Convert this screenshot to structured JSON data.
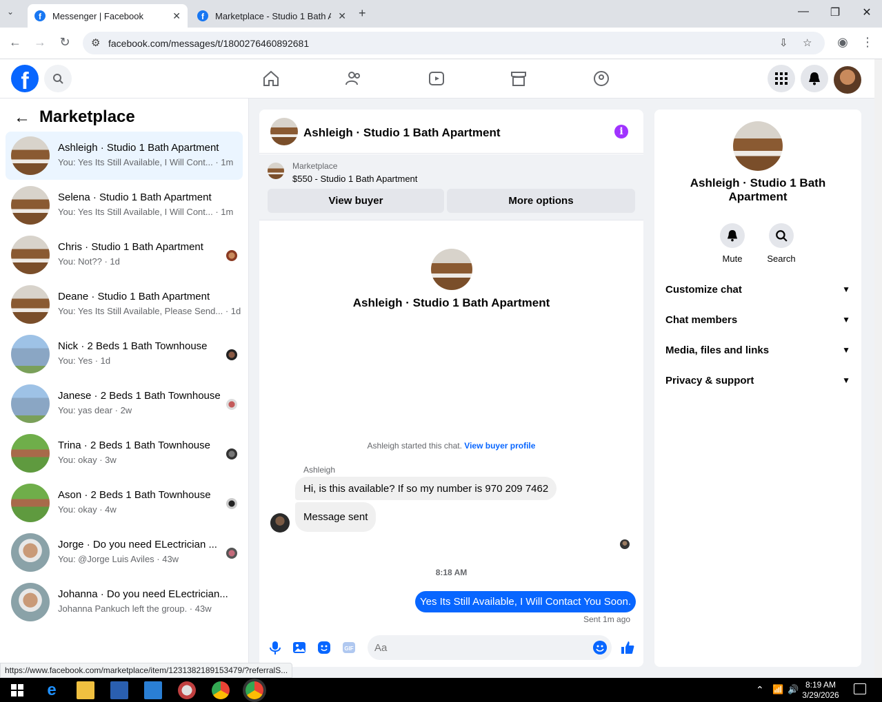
{
  "browser": {
    "tabs": [
      {
        "title": "Messenger | Facebook",
        "active": true
      },
      {
        "title": "Marketplace - Studio 1 Bath Ap",
        "active": false
      }
    ],
    "url": "facebook.com/messages/t/1800276460892681",
    "status_url": "https://www.facebook.com/marketplace/item/1231382189153479/?referralS..."
  },
  "sidebar": {
    "title": "Marketplace",
    "conversations": [
      {
        "name": "Ashleigh · Studio 1 Bath Apartment",
        "preview": "You: Yes Its Still Available, I Will Cont... · 1m",
        "thumb": "apartment",
        "active": true
      },
      {
        "name": "Selena · Studio 1 Bath Apartment",
        "preview": "You: Yes Its Still Available, I Will Cont... · 1m",
        "thumb": "apartment"
      },
      {
        "name": "Chris · Studio 1 Bath Apartment",
        "preview": "You: Not?? · 1d",
        "thumb": "apartment"
      },
      {
        "name": "Deane · Studio 1 Bath Apartment",
        "preview": "You: Yes Its Still Available, Please Send... · 1d",
        "thumb": "apartment"
      },
      {
        "name": "Nick · 2 Beds 1 Bath Townhouse",
        "preview": "You: Yes · 1d",
        "thumb": "house"
      },
      {
        "name": "Janese · 2 Beds 1 Bath Townhouse",
        "preview": "You: yas dear · 2w",
        "thumb": "house"
      },
      {
        "name": "Trina · 2 Beds 1 Bath Townhouse",
        "preview": "You: okay · 3w",
        "thumb": "garden"
      },
      {
        "name": "Ason · 2 Beds 1 Bath Townhouse",
        "preview": "You: okay · 4w",
        "thumb": "garden"
      },
      {
        "name": "Jorge · Do you need ELectrician ...",
        "preview": "You: @Jorge Luis Aviles · 43w",
        "thumb": "man"
      },
      {
        "name": "Johanna · Do you need ELectrician...",
        "preview": "Johanna Pankuch left the group. · 43w",
        "thumb": "man"
      }
    ]
  },
  "chat": {
    "title": "Ashleigh · Studio 1 Bath Apartment",
    "marketplace_label": "Marketplace",
    "listing": "$550 - Studio 1 Bath Apartment",
    "view_buyer": "View buyer",
    "more_options": "More options",
    "started_text": "Ashleigh started this chat.",
    "view_buyer_profile": "View buyer profile",
    "sender": "Ashleigh",
    "incoming": [
      "Hi, is this available? If so my number is 970 209 7462",
      "Message sent"
    ],
    "timestamp": "8:18 AM",
    "outgoing": "Yes Its Still Available, I Will Contact You Soon.",
    "sent_status": "Sent 1m ago",
    "input_placeholder": "Aa"
  },
  "details": {
    "name": "Ashleigh · Studio 1 Bath Apartment",
    "mute": "Mute",
    "search": "Search",
    "sections": [
      "Customize chat",
      "Chat members",
      "Media, files and links",
      "Privacy & support"
    ]
  },
  "taskbar": {
    "time": "8:19 AM",
    "date": "3/29/2026"
  },
  "colors": {
    "fb_blue": "#0866ff",
    "info_purple": "#a033ff",
    "active_row": "#ebf5ff"
  }
}
